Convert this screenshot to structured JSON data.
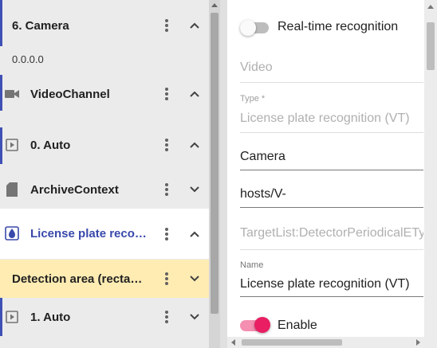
{
  "tree": {
    "items": [
      {
        "label": "6. Camera",
        "icon": "none",
        "expanded": true
      },
      {
        "ip": "0.0.0.0"
      },
      {
        "label": "VideoChannel",
        "icon": "videocam-icon",
        "expanded": true
      },
      {
        "label": "0. Auto",
        "icon": "play-box-icon",
        "expanded": true
      },
      {
        "label": "ArchiveContext",
        "icon": "sd-card-icon",
        "expanded": false
      },
      {
        "label": "License plate recognition (VT)",
        "icon": "license-plate-detector-icon",
        "expanded": true
      },
      {
        "label": "Detection area (rectangle)",
        "expanded": false
      },
      {
        "label": "1. Auto",
        "icon": "play-box-icon",
        "expanded": false
      }
    ]
  },
  "props": {
    "realtime_label": "Real-time recognition",
    "video_label": "Video",
    "type_label": "Type *",
    "type_value": "License plate recognition (VT)",
    "camera_value": "Camera",
    "hosts_value": "hosts/V-",
    "target_value": "TargetList:DetectorPeriodicalETy",
    "name_label": "Name",
    "name_value": "License plate recognition (VT)",
    "enable_label": "Enable"
  },
  "colors": {
    "accent": "#3f51b5",
    "selected_bg": "#ffecb3",
    "toggle_on": "#e91e63",
    "toggle_on_track": "#f48fb1"
  }
}
